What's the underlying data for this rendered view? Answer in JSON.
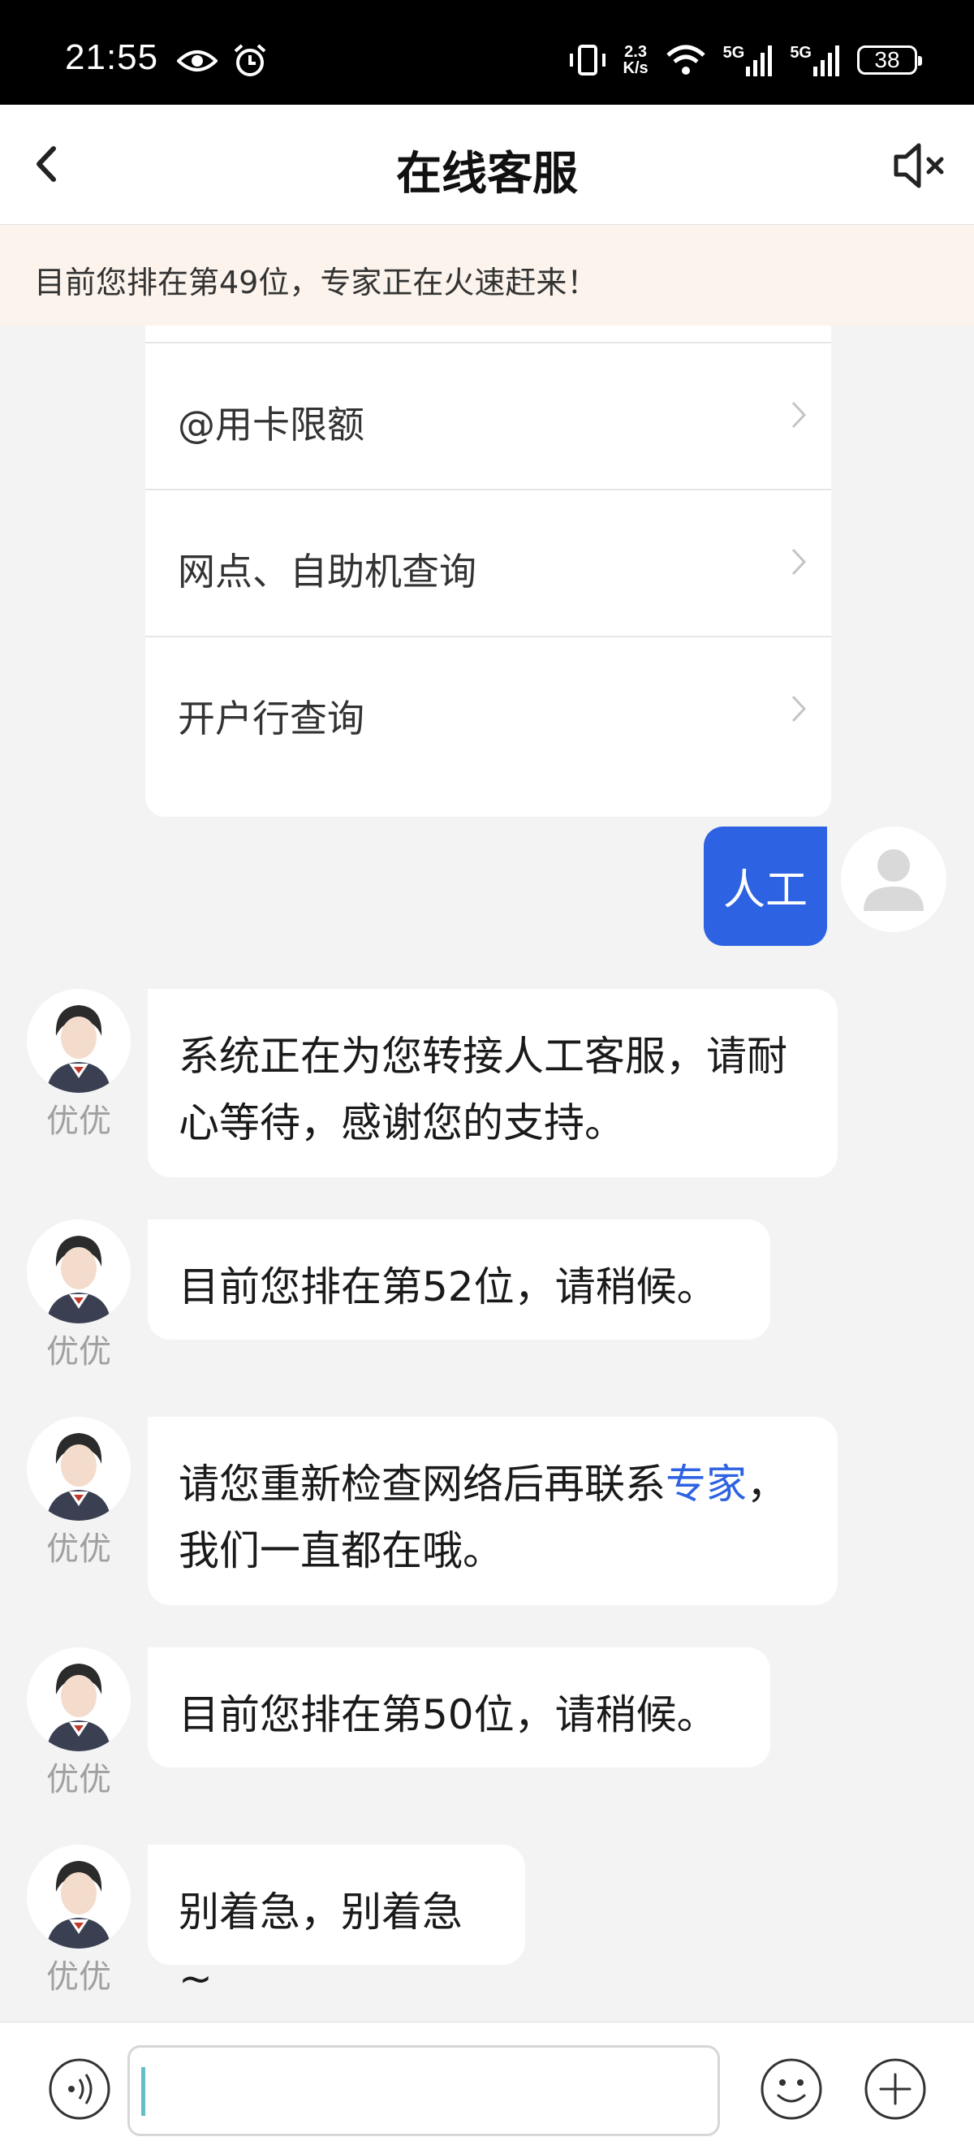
{
  "status_bar": {
    "time": "21:55",
    "speed_top": "2.3",
    "speed_bottom": "K/s",
    "net1": "5G",
    "net2": "5G",
    "battery": "38",
    "icons": [
      "eye-icon",
      "alarm-icon",
      "vibrate-icon",
      "wifi-icon",
      "signal-icon",
      "battery-icon"
    ]
  },
  "nav": {
    "title": "在线客服",
    "back_icon": "chevron-left-icon",
    "mute_icon": "speaker-muted-icon"
  },
  "notice": {
    "text": "目前您排在第49位，专家正在火速赶来！"
  },
  "menu": {
    "items": [
      {
        "label": "@用卡限额"
      },
      {
        "label": "网点、自助机查询"
      },
      {
        "label": "开户行查询"
      }
    ]
  },
  "user_message": {
    "text": "人工"
  },
  "bot": {
    "name": "优优"
  },
  "bot_messages": [
    {
      "text": "系统正在为您转接人工客服，请耐心等待，感谢您的支持。"
    },
    {
      "text": "目前您排在第52位，请稍候。"
    },
    {
      "text_before": "请您重新检查网络后再联系",
      "link": "专家",
      "text_after": "，我们一直都在哦。"
    },
    {
      "text": "目前您排在第50位，请稍候。"
    },
    {
      "text": "别着急，别着急~"
    }
  ],
  "input_bar": {
    "value": "",
    "placeholder": "",
    "voice_icon": "voice-icon",
    "emoji_icon": "emoji-icon",
    "plus_icon": "plus-icon"
  },
  "colors": {
    "accent": "#2d62e2",
    "chat_background": "#f3f3f3",
    "notice_background": "#fbf3ec",
    "name_gray": "#a0a0a0"
  }
}
